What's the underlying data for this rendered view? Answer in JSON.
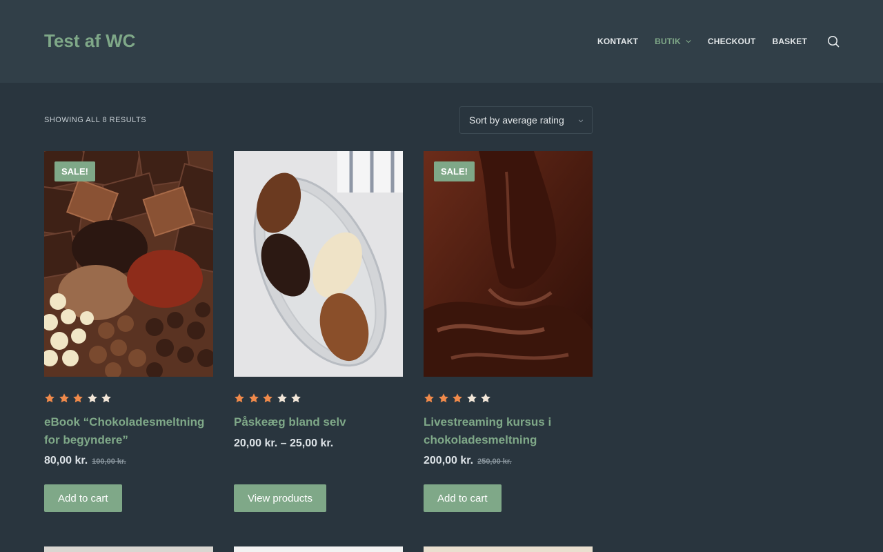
{
  "header": {
    "site_title": "Test af WC",
    "nav": [
      "KONTAKT",
      "BUTIK",
      "CHECKOUT",
      "BASKET"
    ],
    "active_nav": "BUTIK"
  },
  "toolbar": {
    "result_count": "SHOWING ALL 8 RESULTS",
    "sort_selected": "Sort by average rating"
  },
  "colors": {
    "accent": "#7fa888",
    "header_bg": "#313f48",
    "page_bg": "#29353e",
    "star_filled": "#f08a4b",
    "star_empty": "#f2e6d8"
  },
  "products": [
    {
      "badge": "SALE!",
      "rating": 3,
      "rating_max": 5,
      "title": "eBook “Chokoladesmeltning for begyndere”",
      "price": "80,00 kr.",
      "old_price": "100,00 kr.",
      "button": "Add to cart"
    },
    {
      "badge": "",
      "rating": 3,
      "rating_max": 5,
      "title": "Påskeæg bland selv",
      "price": "20,00 kr. – 25,00 kr.",
      "old_price": "",
      "button": "View products"
    },
    {
      "badge": "SALE!",
      "rating": 3,
      "rating_max": 5,
      "title": "Livestreaming kursus i chokoladesmeltning",
      "price": "200,00 kr.",
      "old_price": "250,00 kr.",
      "button": "Add to cart"
    }
  ]
}
